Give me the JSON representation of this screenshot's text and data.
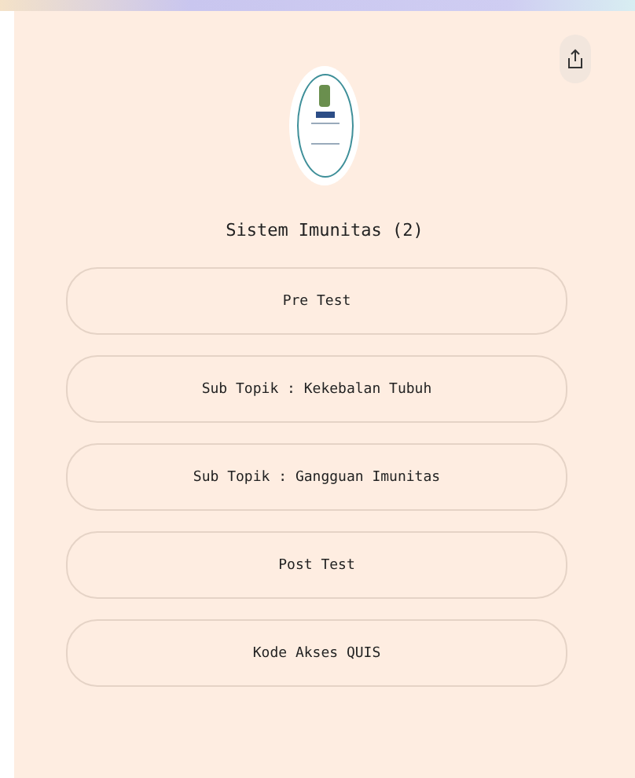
{
  "title": "Sistem Imunitas (2)",
  "links": [
    {
      "label": "Pre Test"
    },
    {
      "label": "Sub Topik : Kekebalan Tubuh"
    },
    {
      "label": "Sub Topik : Gangguan Imunitas"
    },
    {
      "label": "Post Test"
    },
    {
      "label": "Kode Akses QUIS"
    }
  ]
}
